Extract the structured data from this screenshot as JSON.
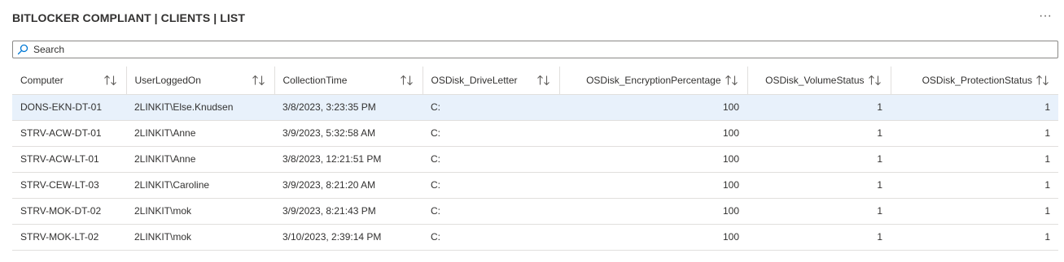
{
  "header": {
    "title": "BITLOCKER COMPLIANT | CLIENTS | LIST",
    "more_label": "···"
  },
  "search": {
    "placeholder": "Search",
    "value": "",
    "icon": "search-icon"
  },
  "table": {
    "columns": [
      {
        "label": "Computer",
        "align": "left"
      },
      {
        "label": "UserLoggedOn",
        "align": "left"
      },
      {
        "label": "CollectionTime",
        "align": "left"
      },
      {
        "label": "OSDisk_DriveLetter",
        "align": "left"
      },
      {
        "label": "OSDisk_EncryptionPercentage",
        "align": "right"
      },
      {
        "label": "OSDisk_VolumeStatus",
        "align": "right"
      },
      {
        "label": "OSDisk_ProtectionStatus",
        "align": "right"
      }
    ],
    "rows": [
      {
        "computer": "DONS-EKN-DT-01",
        "user": "2LINKIT\\Else.Knudsen",
        "time": "3/8/2023, 3:23:35 PM",
        "drive": "C:",
        "enc": "100",
        "vol": "1",
        "prot": "1"
      },
      {
        "computer": "STRV-ACW-DT-01",
        "user": "2LINKIT\\Anne",
        "time": "3/9/2023, 5:32:58 AM",
        "drive": "C:",
        "enc": "100",
        "vol": "1",
        "prot": "1"
      },
      {
        "computer": "STRV-ACW-LT-01",
        "user": "2LINKIT\\Anne",
        "time": "3/8/2023, 12:21:51 PM",
        "drive": "C:",
        "enc": "100",
        "vol": "1",
        "prot": "1"
      },
      {
        "computer": "STRV-CEW-LT-03",
        "user": "2LINKIT\\Caroline",
        "time": "3/9/2023, 8:21:20 AM",
        "drive": "C:",
        "enc": "100",
        "vol": "1",
        "prot": "1"
      },
      {
        "computer": "STRV-MOK-DT-02",
        "user": "2LINKIT\\mok",
        "time": "3/9/2023, 8:21:43 PM",
        "drive": "C:",
        "enc": "100",
        "vol": "1",
        "prot": "1"
      },
      {
        "computer": "STRV-MOK-LT-02",
        "user": "2LINKIT\\mok",
        "time": "3/10/2023, 2:39:14 PM",
        "drive": "C:",
        "enc": "100",
        "vol": "1",
        "prot": "1"
      }
    ],
    "selected_row": 0,
    "sort_icon": "sort-up-down-icon"
  },
  "colors": {
    "selected_row_bg": "#e8f1fb",
    "border": "#e1dfdd",
    "text": "#323130",
    "search_icon": "#0078d4"
  }
}
